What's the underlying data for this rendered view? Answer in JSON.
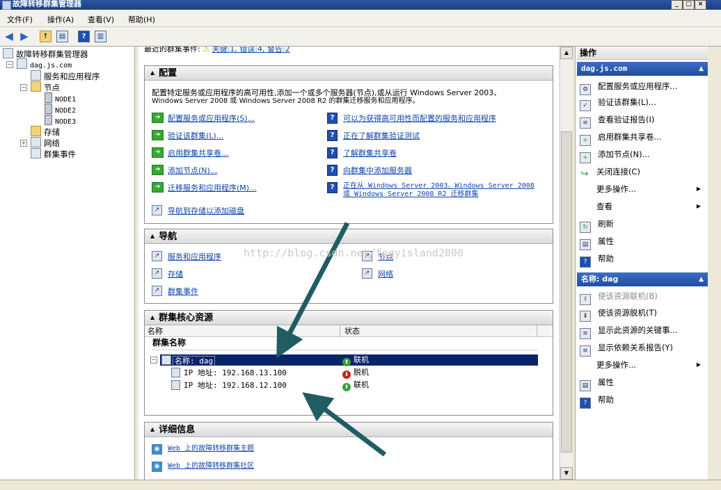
{
  "window": {
    "title": "故障转移群集管理器",
    "buttons": [
      "_",
      "□",
      "×"
    ]
  },
  "menu": [
    "文件(F)",
    "操作(A)",
    "查看(V)",
    "帮助(H)"
  ],
  "tree": {
    "root": "故障转移群集管理器",
    "cluster": "dag.js.com",
    "services": "服务和应用程序",
    "nodes_label": "节点",
    "nodes": [
      "NODE1",
      "NODE2",
      "NODE3"
    ],
    "storage": "存储",
    "network": "网络",
    "events": "群集事件"
  },
  "center": {
    "recent_events_label": "最近的群集事件:",
    "recent_events_value": "关键:1, 错误:4, 警告:2",
    "config": {
      "title": "配置",
      "desc_line1": "配置特定服务或应用程序的高可用性,添加一个或多个服务器(节点),或从运行 Windows Server 2003、",
      "desc_line2": "Windows Server 2008 或 Windows Server 2008 R2 的群集迁移服务和应用程序。",
      "left_links": [
        "配置服务或应用程序(S)...",
        "验证该群集(L)...",
        "启用群集共享卷...",
        "添加节点(N)...",
        "迁移服务和应用程序(M)...",
        "导航到存储以添加磁盘"
      ],
      "right_links": [
        "可以为获得高可用性而配置的服务和应用程序",
        "正在了解群集验证测试",
        "了解群集共享卷",
        "向群集中添加服务器"
      ],
      "right_link5_line1": "正在从 Windows Server 2003、Windows Server 2008",
      "right_link5_line2": "或 Windows Server 2008 R2 迁移群集"
    },
    "navigation": {
      "title": "导航",
      "links": [
        "服务和应用程序",
        "存储",
        "群集事件",
        "节点",
        "网络"
      ]
    },
    "core": {
      "title": "群集核心资源",
      "col_name": "名称",
      "col_status": "状态",
      "group": "群集名称",
      "rows": [
        {
          "name": "名称: dag",
          "status": "联机",
          "state": "up"
        },
        {
          "name": "IP 地址: 192.168.13.100",
          "status": "脱机",
          "state": "down"
        },
        {
          "name": "IP 地址: 192.168.12.100",
          "status": "联机",
          "state": "up"
        }
      ]
    },
    "details": {
      "title": "详细信息",
      "links": [
        "Web 上的故障转移群集主题",
        "Web 上的故障转移群集社区"
      ]
    }
  },
  "actions": {
    "title": "操作",
    "group1": "dag.js.com",
    "group1_items": [
      "配置服务或应用程序...",
      "验证该群集(L)...",
      "查看验证报告(I)",
      "启用群集共享卷...",
      "添加节点(N)...",
      "关闭连接(C)",
      "更多操作...",
      "查看",
      "刷新",
      "属性",
      "帮助"
    ],
    "group2": "名称: dag",
    "group2_items": [
      "使该资源联机(B)",
      "使该资源脱机(T)",
      "显示此资源的关键事...",
      "显示依赖关系报告(Y)",
      "更多操作...",
      "属性",
      "帮助"
    ]
  },
  "watermark": "http://blog.csdn.net/fogyisland2000",
  "colors": {
    "link": "#1144aa",
    "selection": "#0a246a",
    "header_blue": "#2b5cb0",
    "arrow": "#1f5d63"
  }
}
